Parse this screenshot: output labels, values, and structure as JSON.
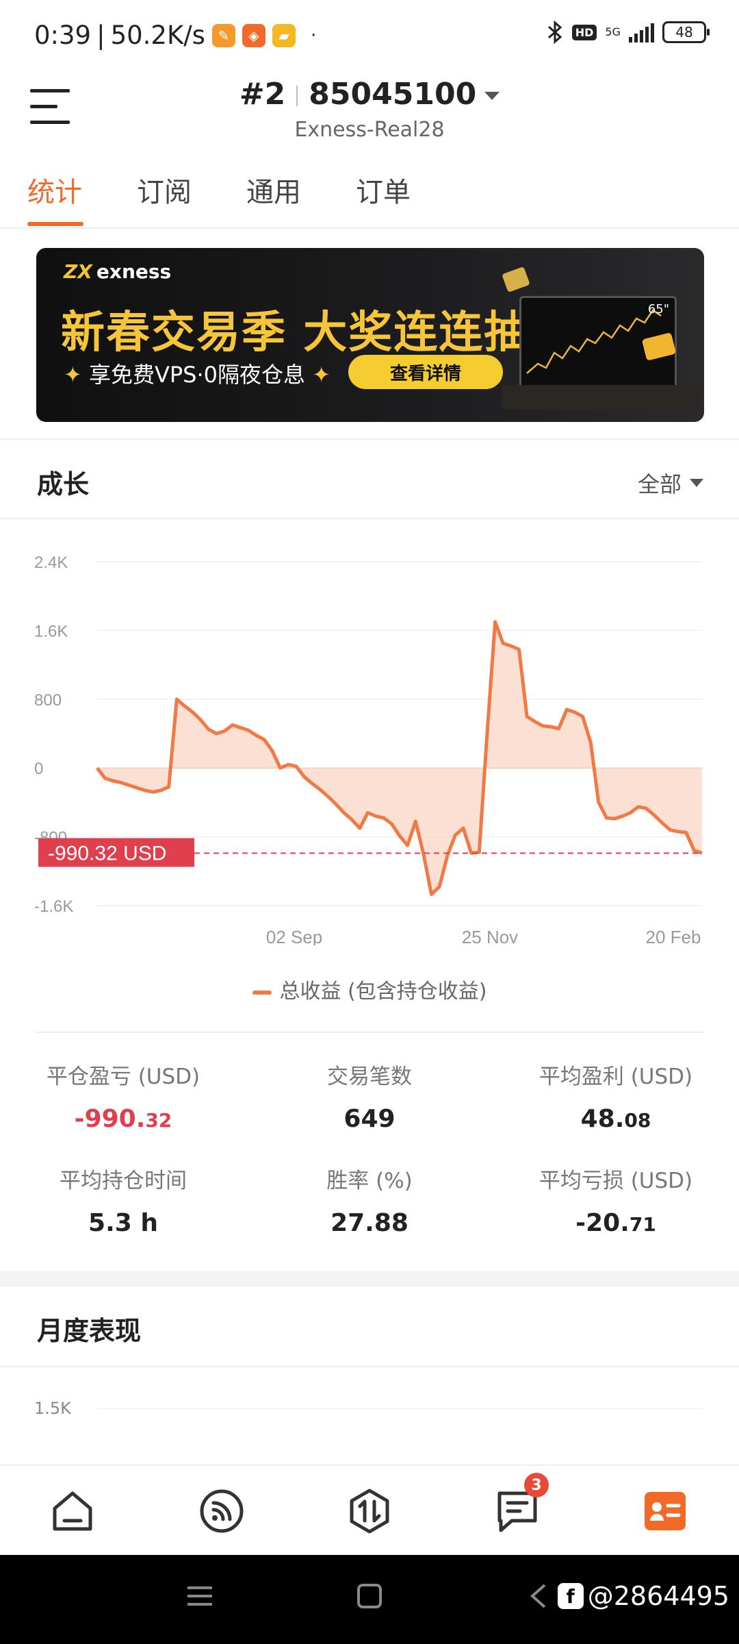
{
  "status_bar": {
    "time": "0:39",
    "speed": "50.2K/s",
    "dot": "·",
    "network": "5G",
    "hd": "HD",
    "battery": "48"
  },
  "header": {
    "account_no": "#2",
    "account_id": "85045100",
    "server": "Exness-Real28"
  },
  "tabs": [
    {
      "label": "统计",
      "active": true
    },
    {
      "label": "订阅",
      "active": false
    },
    {
      "label": "通用",
      "active": false
    },
    {
      "label": "订单",
      "active": false
    }
  ],
  "banner": {
    "brand": "exness",
    "headline": "新春交易季 大奖连连抽",
    "subline": "享免费VPS·0隔夜仓息",
    "button": "查看详情",
    "tv_label": "65\""
  },
  "growth": {
    "title": "成长",
    "filter": "全部"
  },
  "chart_data": {
    "type": "area",
    "y_ticks": [
      "2.4K",
      "1.6K",
      "800",
      "0",
      "-800",
      "-1.6K"
    ],
    "x_ticks": [
      "02 Sep",
      "25 Nov",
      "20 Feb"
    ],
    "ylim": [
      -1600,
      2400
    ],
    "current_value_label": "-990.32 USD",
    "current_value": -990.32,
    "legend": "总收益 (包含持仓收益)",
    "colors": {
      "line": "#ef7a45",
      "fill": "#fbd6c4",
      "marker": "#e0404e"
    },
    "values": [
      0,
      -120,
      -150,
      -170,
      -200,
      -230,
      -260,
      -280,
      -260,
      -220,
      800,
      720,
      650,
      560,
      450,
      400,
      430,
      500,
      470,
      440,
      380,
      330,
      200,
      0,
      40,
      20,
      -100,
      -180,
      -250,
      -330,
      -420,
      -520,
      -600,
      -700,
      -520,
      -560,
      -580,
      -650,
      -790,
      -900,
      -620,
      -1000,
      -1470,
      -1380,
      -1020,
      -780,
      -700,
      -990,
      -980,
      400,
      1700,
      1450,
      1420,
      1380,
      600,
      540,
      490,
      480,
      460,
      680,
      650,
      600,
      300,
      -400,
      -580,
      -590,
      -560,
      -520,
      -450,
      -470,
      -550,
      -640,
      -720,
      -740,
      -750,
      -960,
      -990
    ]
  },
  "stats": [
    {
      "label": "平仓盈亏 (USD)",
      "main": "-990.",
      "frac": "32",
      "negative": true
    },
    {
      "label": "交易笔数",
      "main": "649",
      "frac": "",
      "negative": false
    },
    {
      "label": "平均盈利 (USD)",
      "main": "48.",
      "frac": "08",
      "negative": false
    },
    {
      "label": "平均持仓时间",
      "main": "5.3 h",
      "frac": "",
      "negative": false
    },
    {
      "label": "胜率 (%)",
      "main": "27.88",
      "frac": "",
      "negative": false
    },
    {
      "label": "平均亏损 (USD)",
      "main": "-20.",
      "frac": "71",
      "negative": false
    }
  ],
  "monthly": {
    "title": "月度表现",
    "tick": "1.5K"
  },
  "bottom_nav": {
    "items": [
      "home-icon",
      "feed-icon",
      "trade-icon",
      "messages-icon",
      "profile-icon"
    ],
    "messages_badge": "3",
    "active_color": "#f26a2a"
  },
  "watermark": "@2864495"
}
